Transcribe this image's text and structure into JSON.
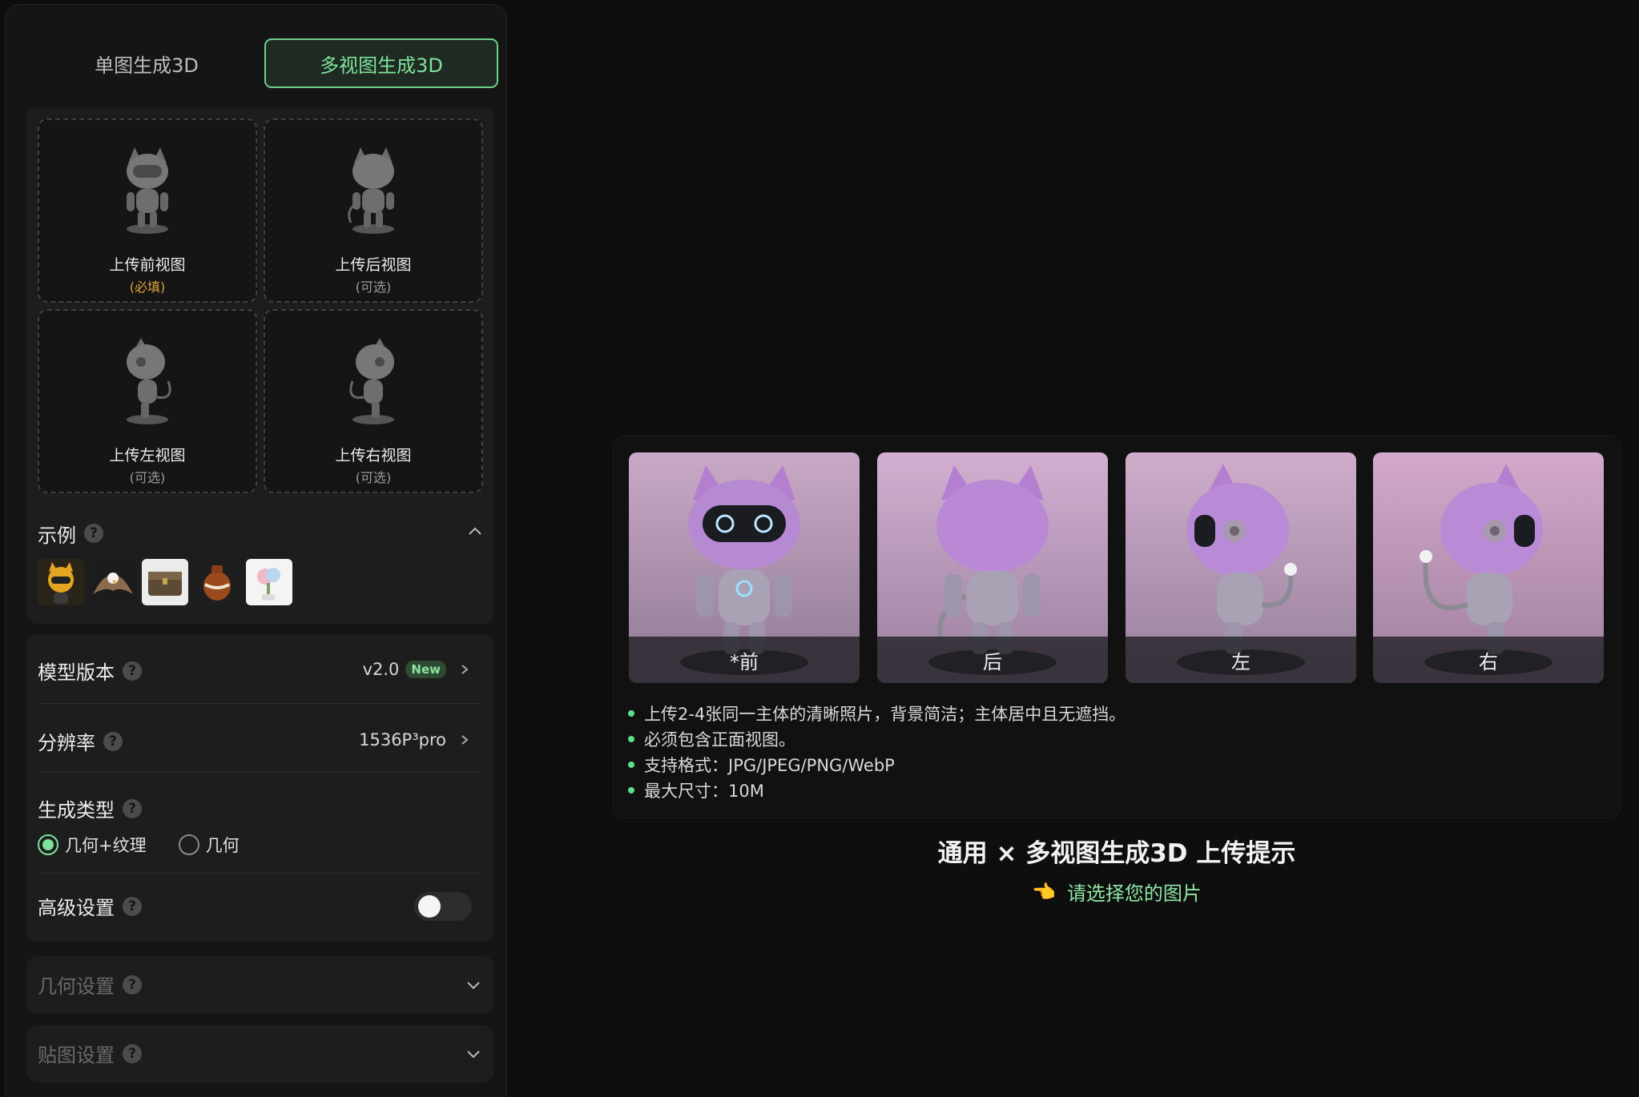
{
  "tabs": {
    "single": "单图生成3D",
    "multi": "多视图生成3D"
  },
  "slots": [
    {
      "label": "上传前视图",
      "sub": "(必填)"
    },
    {
      "label": "上传后视图",
      "sub": "(可选)"
    },
    {
      "label": "上传左视图",
      "sub": "(可选)"
    },
    {
      "label": "上传右视图",
      "sub": "(可选)"
    }
  ],
  "examples": {
    "title": "示例",
    "help": "?"
  },
  "settings": {
    "model": {
      "label": "模型版本",
      "value": "v2.0",
      "badge": "New"
    },
    "resolution": {
      "label": "分辨率",
      "value": "1536P³pro"
    },
    "gen_type": {
      "label": "生成类型",
      "opt_a": "几何+纹理",
      "opt_b": "几何",
      "selected": "几何+纹理"
    },
    "advanced": {
      "label": "高级设置",
      "enabled": false
    }
  },
  "collapses": {
    "geometry": "几何设置",
    "texture": "贴图设置"
  },
  "views": [
    "*前",
    "后",
    "左",
    "右"
  ],
  "tips": [
    "上传2-4张同一主体的清晰照片，背景简洁；主体居中且无遮挡。",
    "必须包含正面视图。",
    "支持格式：JPG/JPEG/PNG/WebP",
    "最大尺寸：10M"
  ],
  "hint": {
    "title": "通用 × 多视图生成3D 上传提示",
    "sub": "请选择您的图片",
    "hand": "👈"
  },
  "colors": {
    "accent": "#7ee29a",
    "required": "#e2a53a",
    "bg": "#0e0e0e",
    "panel": "#151515"
  },
  "icons": [
    "robot-cat-thumb",
    "help-icon",
    "chevron-up-icon",
    "chevron-right-icon",
    "chevron-down-icon",
    "pointing-hand-icon"
  ]
}
